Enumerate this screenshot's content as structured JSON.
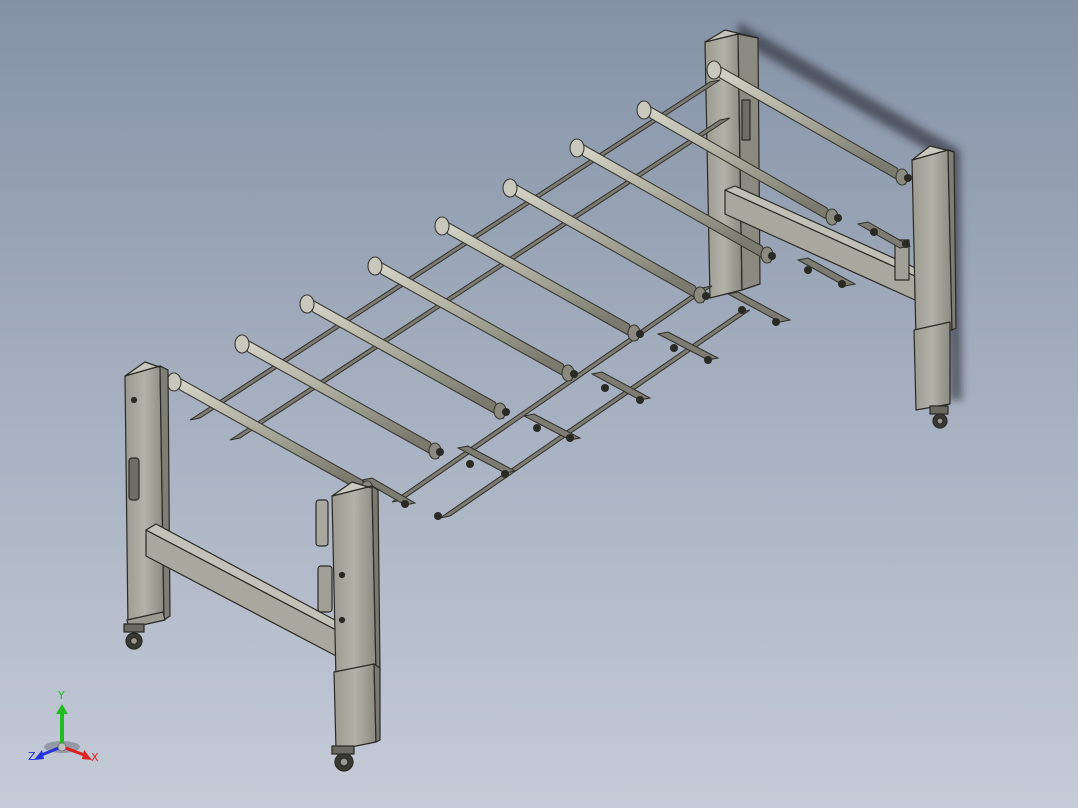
{
  "viewport": {
    "background_top": "#8592a6",
    "background_bottom": "#c5cbd7"
  },
  "model": {
    "name": "telescopic-roller-conveyor",
    "roller_count": 9,
    "frame_color": "#5a5a50",
    "roller_color": "#b4b4a6"
  },
  "triad": {
    "x_label": "X",
    "y_label": "Y",
    "z_label": "Z",
    "x_color": "#dd2222",
    "y_color": "#22bb22",
    "z_color": "#2233dd"
  }
}
